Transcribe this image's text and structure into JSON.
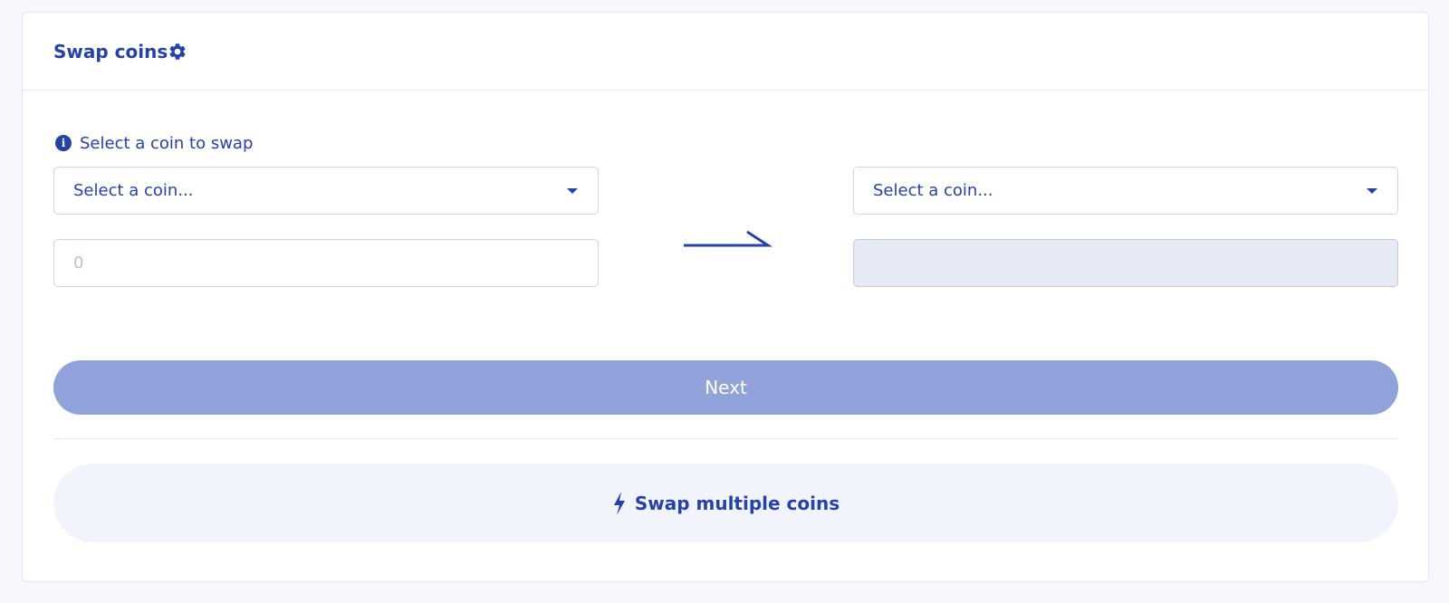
{
  "colors": {
    "brand": "#2641a8",
    "button_disabled": "#91a2da",
    "background": "#f6f7fc",
    "output_field_bg": "#e6eaf4"
  },
  "header": {
    "title": "Swap coins",
    "settings_icon": "gear-icon"
  },
  "info": {
    "icon": "info-icon",
    "text": "Select a coin to swap"
  },
  "from": {
    "select_label": "Select a coin...",
    "amount_placeholder": "0",
    "amount_value": ""
  },
  "to": {
    "select_label": "Select a coin...",
    "amount_value": ""
  },
  "arrow_icon": "arrow-right-icon",
  "next_button": {
    "label": "Next",
    "enabled": false
  },
  "multi_swap": {
    "icon": "bolt-icon",
    "label": "Swap multiple coins"
  }
}
